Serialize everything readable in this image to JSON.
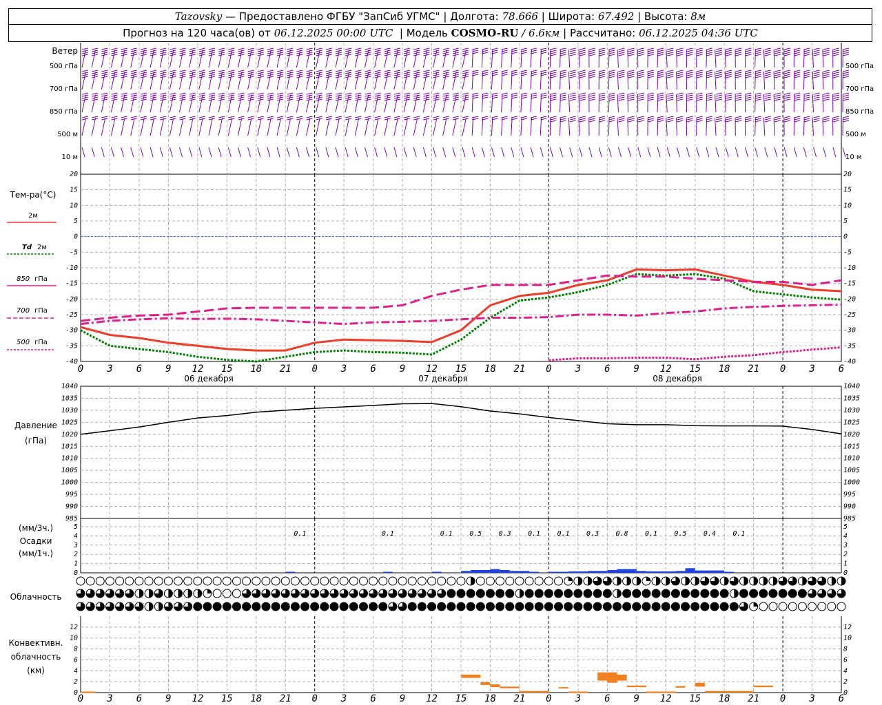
{
  "header": {
    "station": "Tazovsky",
    "dash": " — ",
    "provider": "Предоставлено ФГБУ \"ЗапСиб УГМС\"",
    "lon_label": "Долгота:",
    "lon_value": "78.666",
    "lat_label": "Широта:",
    "lat_value": "67.492",
    "alt_label": "Высота:",
    "alt_value": "8м",
    "forecast_prefix": "Прогноз на 120 часа(ов) от",
    "forecast_start": "06.12.2025 00:00 UTC",
    "model_label": "Модель",
    "model_name": "COSMO-RU",
    "model_res": "/ 6.6км",
    "calc_label": "Рассчитано:",
    "calc_time": "06.12.2025 04:36 UTC"
  },
  "x_ticks": [
    "0",
    "3",
    "6",
    "9",
    "12",
    "15",
    "18",
    "21",
    "0",
    "3",
    "6",
    "9",
    "12",
    "15",
    "18",
    "21",
    "0",
    "3",
    "6",
    "9",
    "12",
    "15",
    "18",
    "21",
    "0",
    "3",
    "6"
  ],
  "day_labels": [
    "06 декабря",
    "07 декабря",
    "08 декабря"
  ],
  "wind": {
    "title": "Ветер",
    "levels": [
      "500 гПа",
      "700 гПа",
      "850 гПа",
      "500 м",
      "10 м"
    ],
    "color": "#8000c0"
  },
  "temp_legend": {
    "title": "Тем-ра(°C)",
    "t2m": "2м",
    "td_sym": "Td",
    "td_lvl": "2м",
    "t850_num": "850",
    "t850_unit": "гПа",
    "t700_num": "700",
    "t700_unit": "гПа",
    "t500_num": "500",
    "t500_unit": "гПа"
  },
  "pressure_legend": {
    "title": "Давление",
    "unit": "(гПа)"
  },
  "precip_legend": {
    "unit3": "(мм/3ч.)",
    "title": "Осадки",
    "unit1": "(мм/1ч.)"
  },
  "cloud_legend": {
    "title": "Облачность"
  },
  "conv_legend": {
    "line1": "Конвективн.",
    "line2": "облачность",
    "line3": "(км)"
  },
  "chart_data": [
    {
      "type": "line",
      "title": "Тем-ра(°C)",
      "x_hours": [
        0,
        3,
        6,
        9,
        12,
        15,
        18,
        21,
        24,
        27,
        30,
        33,
        36,
        39,
        42,
        45,
        48,
        51,
        54,
        57,
        60,
        63,
        66,
        69,
        72,
        75,
        78
      ],
      "ylim": [
        -40,
        20
      ],
      "y_ticks": [
        20,
        15,
        10,
        5,
        0,
        -5,
        -10,
        -15,
        -20,
        -25,
        -30,
        -35,
        -40
      ],
      "zero_line": true,
      "series": [
        {
          "name": "2м",
          "color": "#f03c2a",
          "style": "solid",
          "values": [
            -29,
            -31.5,
            -32.5,
            -34,
            -35,
            -36,
            -36.5,
            -36.5,
            -34,
            -33,
            -33.2,
            -33.4,
            -33.8,
            -30,
            -22,
            -19,
            -18,
            -15.5,
            -14,
            -10.5,
            -10.8,
            -10.5,
            -12.5,
            -14.5,
            -15.5,
            -17,
            -17.5
          ]
        },
        {
          "name": "Td 2м",
          "color": "#008000",
          "style": "dotted",
          "values": [
            -30,
            -35,
            -36,
            -37,
            -38.5,
            -39.5,
            -40,
            -38.5,
            -37,
            -36.5,
            -37,
            -37.2,
            -37.8,
            -33,
            -26,
            -20.5,
            -19.5,
            -17.8,
            -15.5,
            -12,
            -12.5,
            -12,
            -13.5,
            -17.5,
            -18.5,
            -19.5,
            -20.2
          ]
        },
        {
          "name": "850 гПа",
          "color": "#e0208a",
          "style": "dashed",
          "values": [
            -27,
            -26,
            -25.3,
            -25,
            -24,
            -23,
            -22.8,
            -22.8,
            -22.8,
            -22.8,
            -22.8,
            -22,
            -19,
            -17,
            -15.5,
            -15.5,
            -15.5,
            -14,
            -12.5,
            -12.8,
            -12.8,
            -13.5,
            -14,
            -14.5,
            -14.5,
            -15.5,
            -14
          ]
        },
        {
          "name": "700 гПа",
          "color": "#e0208a",
          "style": "dashdot",
          "values": [
            -28,
            -27,
            -26.5,
            -26.2,
            -26.4,
            -26.3,
            -26.5,
            -27,
            -27.5,
            -28,
            -27.5,
            -27.3,
            -27,
            -26.5,
            -26,
            -26,
            -25.8,
            -25,
            -25,
            -25.3,
            -24.5,
            -24,
            -23,
            -22.5,
            -22.2,
            -22,
            -21.8
          ]
        },
        {
          "name": "500 гПа",
          "color": "#e0208a",
          "style": "dotted",
          "x_hours": [
            48,
            51,
            54,
            57,
            60,
            63,
            66,
            69,
            72,
            75,
            78
          ],
          "values": [
            -39.6,
            -39,
            -39,
            -38.8,
            -38.8,
            -39.3,
            -38.5,
            -38,
            -37,
            -36.2,
            -35.5
          ]
        }
      ]
    },
    {
      "type": "line",
      "title": "Давление",
      "x_hours": [
        0,
        3,
        6,
        9,
        12,
        15,
        18,
        21,
        24,
        27,
        30,
        33,
        36,
        39,
        42,
        45,
        48,
        51,
        54,
        57,
        60,
        63,
        66,
        69,
        72,
        75,
        78
      ],
      "ylim": [
        985,
        1040
      ],
      "y_ticks": [
        1040,
        1035,
        1030,
        1025,
        1020,
        1015,
        1010,
        1005,
        1000,
        995,
        990,
        985
      ],
      "series": [
        {
          "name": "Давление",
          "color": "#000000",
          "style": "solid",
          "values": [
            1020,
            1021.5,
            1023,
            1025,
            1026.8,
            1027.8,
            1029.2,
            1030,
            1030.8,
            1031.4,
            1032,
            1032.7,
            1032.8,
            1031.5,
            1029.7,
            1028.5,
            1027,
            1025.7,
            1024.4,
            1024,
            1024,
            1023.6,
            1023.5,
            1023.5,
            1023.4,
            1022,
            1020.2
          ]
        }
      ]
    },
    {
      "type": "bar",
      "title": "Осадки",
      "ylim": [
        0,
        5
      ],
      "y_ticks": [
        5,
        4,
        3,
        2,
        1,
        0
      ],
      "labels_3h": [
        {
          "hour": 22.5,
          "text": "0.1"
        },
        {
          "hour": 31.5,
          "text": "0.1"
        },
        {
          "hour": 37.5,
          "text": "0.1"
        },
        {
          "hour": 40.5,
          "text": "0.5"
        },
        {
          "hour": 43.5,
          "text": "0.3"
        },
        {
          "hour": 46.5,
          "text": "0.1"
        },
        {
          "hour": 49.5,
          "text": "0.1"
        },
        {
          "hour": 52.5,
          "text": "0.3"
        },
        {
          "hour": 55.5,
          "text": "0.8"
        },
        {
          "hour": 58.5,
          "text": "0.1"
        },
        {
          "hour": 61.5,
          "text": "0.5"
        },
        {
          "hour": 64.5,
          "text": "0.4"
        },
        {
          "hour": 67.5,
          "text": "0.1"
        }
      ],
      "hourly_mm": [
        {
          "start": 21,
          "end": 22,
          "value": 0.1
        },
        {
          "start": 31,
          "end": 32,
          "value": 0.1
        },
        {
          "start": 36,
          "end": 37,
          "value": 0.1
        },
        {
          "start": 39,
          "end": 40,
          "value": 0.2
        },
        {
          "start": 40,
          "end": 42,
          "value": 0.3
        },
        {
          "start": 42,
          "end": 43,
          "value": 0.4
        },
        {
          "start": 43,
          "end": 44,
          "value": 0.3
        },
        {
          "start": 44,
          "end": 46,
          "value": 0.2
        },
        {
          "start": 46,
          "end": 47,
          "value": 0.1
        },
        {
          "start": 48,
          "end": 50,
          "value": 0.1
        },
        {
          "start": 50,
          "end": 52,
          "value": 0.15
        },
        {
          "start": 52,
          "end": 54,
          "value": 0.2
        },
        {
          "start": 54,
          "end": 55,
          "value": 0.3
        },
        {
          "start": 55,
          "end": 57,
          "value": 0.4
        },
        {
          "start": 57,
          "end": 58,
          "value": 0.2
        },
        {
          "start": 58,
          "end": 61,
          "value": 0.15
        },
        {
          "start": 61,
          "end": 62,
          "value": 0.2
        },
        {
          "start": 62,
          "end": 63,
          "value": 0.5
        },
        {
          "start": 63,
          "end": 66,
          "value": 0.25
        },
        {
          "start": 66,
          "end": 67,
          "value": 0.1
        }
      ],
      "color": "#2040e0"
    },
    {
      "type": "table",
      "title": "Облачность",
      "rows": [
        "high",
        "middle",
        "low"
      ],
      "step_hours": 1,
      "values_eighths": {
        "high": [
          0,
          0,
          0,
          0,
          0,
          0,
          0,
          0,
          0,
          0,
          0,
          0,
          0,
          0,
          0,
          0,
          0,
          0,
          0,
          0,
          0,
          0,
          0,
          0,
          0,
          0,
          0,
          0,
          0,
          0,
          0,
          0,
          0,
          0,
          0,
          0,
          0,
          0,
          0,
          0,
          4,
          0,
          0,
          0,
          0,
          0,
          0,
          0,
          0,
          0,
          2,
          4,
          4,
          6,
          6,
          4,
          4,
          4,
          2,
          4,
          4,
          6,
          4,
          4,
          6,
          6,
          4,
          6,
          4,
          4,
          4,
          4,
          6,
          6,
          4,
          6,
          6,
          4,
          4
        ],
        "middle": [
          6,
          6,
          6,
          6,
          6,
          6,
          4,
          4,
          6,
          4,
          4,
          4,
          4,
          2,
          0,
          0,
          0,
          6,
          6,
          6,
          6,
          6,
          6,
          6,
          6,
          6,
          6,
          6,
          6,
          6,
          6,
          6,
          6,
          6,
          6,
          6,
          6,
          6,
          8,
          8,
          8,
          8,
          8,
          8,
          8,
          4,
          8,
          8,
          8,
          8,
          8,
          8,
          8,
          8,
          8,
          4,
          8,
          8,
          8,
          8,
          8,
          8,
          8,
          8,
          8,
          8,
          8,
          4,
          8,
          8,
          8,
          8,
          8,
          8,
          8,
          6,
          6,
          6,
          6
        ],
        "low": [
          6,
          6,
          6,
          6,
          6,
          6,
          6,
          4,
          4,
          6,
          6,
          6,
          8,
          8,
          8,
          8,
          8,
          8,
          8,
          8,
          8,
          8,
          8,
          8,
          8,
          8,
          8,
          8,
          8,
          8,
          8,
          8,
          6,
          6,
          8,
          8,
          8,
          8,
          8,
          8,
          8,
          8,
          8,
          8,
          8,
          8,
          8,
          8,
          8,
          8,
          8,
          8,
          8,
          8,
          8,
          8,
          8,
          8,
          8,
          8,
          8,
          8,
          8,
          8,
          8,
          8,
          8,
          8,
          6,
          2,
          0,
          0,
          0,
          0,
          0,
          0,
          0,
          0,
          0
        ]
      }
    },
    {
      "type": "bar",
      "title": "Конвективн. облачность (км)",
      "ylim": [
        0,
        14
      ],
      "y_ticks": [
        12,
        10,
        8,
        6,
        4,
        2,
        0
      ],
      "color": "#f08020",
      "segments": [
        {
          "start": 0,
          "end": 1.5,
          "bottom": 0,
          "top": 0.2
        },
        {
          "start": 39,
          "end": 41,
          "bottom": 2.7,
          "top": 3.3
        },
        {
          "start": 41,
          "end": 42,
          "bottom": 1.4,
          "top": 1.9
        },
        {
          "start": 42,
          "end": 43,
          "bottom": 1,
          "top": 1.5
        },
        {
          "start": 43,
          "end": 45,
          "bottom": 0.8,
          "top": 1.1
        },
        {
          "start": 45,
          "end": 48,
          "bottom": 0,
          "top": 0.3
        },
        {
          "start": 49,
          "end": 50,
          "bottom": 0.8,
          "top": 1
        },
        {
          "start": 50,
          "end": 52,
          "bottom": 0,
          "top": 0.2
        },
        {
          "start": 53,
          "end": 54,
          "bottom": 2.2,
          "top": 3.7
        },
        {
          "start": 54,
          "end": 55,
          "bottom": 1.8,
          "top": 3.7
        },
        {
          "start": 55,
          "end": 56,
          "bottom": 2.2,
          "top": 3.3
        },
        {
          "start": 56,
          "end": 58,
          "bottom": 1,
          "top": 1.3
        },
        {
          "start": 58,
          "end": 61,
          "bottom": 0,
          "top": 0.2
        },
        {
          "start": 61,
          "end": 62,
          "bottom": 0.9,
          "top": 1.2
        },
        {
          "start": 63,
          "end": 64,
          "bottom": 1.1,
          "top": 1.8
        },
        {
          "start": 64,
          "end": 69,
          "bottom": 0,
          "top": 0.3
        },
        {
          "start": 69,
          "end": 71,
          "bottom": 1,
          "top": 1.3
        }
      ]
    }
  ]
}
